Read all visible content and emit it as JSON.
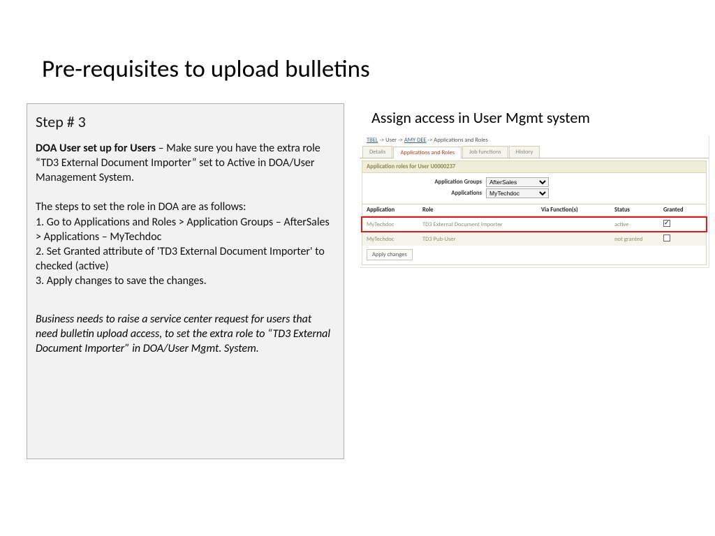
{
  "title": "Pre-requisites to upload bulletins",
  "left": {
    "step": "Step # 3",
    "p1_bold": "DOA User set up for Users",
    "p1_rest": " – Make sure you have the extra role “TD3 External Document Importer” set to Active in DOA/User Management System.",
    "p2": "The steps to set the role in DOA are as follows:",
    "s1": "1. Go to Applications and Roles > Application Groups – AfterSales > Applications – MyTechdoc",
    "s2": "2. Set Granted attribute of 'TD3 External Document Importer' to checked (active)",
    "s3": "3. Apply changes to save the changes.",
    "note": "Business needs to raise a service center request for users that need bulletin upload access, to set the extra role to “TD3 External Document Importer” in DOA/User Mgmt. System."
  },
  "right_caption": "Assign access in User Mgmt system",
  "shot": {
    "bc1": "TBEL",
    "bc2": " -> User -> ",
    "bc3": "AMY DEE",
    "bc4": " -> Applications and Roles",
    "tabs": {
      "t1": "Details",
      "t2": "Applications and Roles",
      "t3": "Job functions",
      "t4": "History"
    },
    "panel_head": "Application roles for User U0000237",
    "label_groups": "Application Groups",
    "val_groups": "AfterSales",
    "label_apps": "Applications",
    "val_apps": "MyTechdoc",
    "cols": {
      "app": "Application",
      "role": "Role",
      "func": "Via Function(s)",
      "status": "Status",
      "granted": "Granted"
    },
    "rows": [
      {
        "app": "MyTechdoc",
        "role": "TD3 External Document Importer",
        "func": "",
        "status": "active",
        "granted": true
      },
      {
        "app": "MyTechdoc",
        "role": "TD3 Pub-User",
        "func": "",
        "status": "not granted",
        "granted": false
      }
    ],
    "apply": "Apply changes"
  }
}
